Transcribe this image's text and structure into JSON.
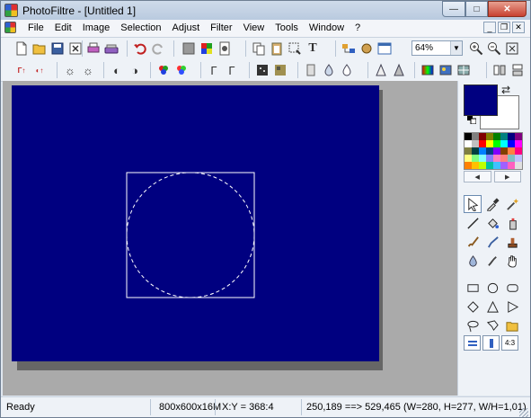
{
  "window": {
    "title": "PhotoFiltre - [Untitled 1]"
  },
  "menu": {
    "items": [
      "File",
      "Edit",
      "Image",
      "Selection",
      "Adjust",
      "Filter",
      "View",
      "Tools",
      "Window",
      "?"
    ]
  },
  "toolbar": {
    "zoom_value": "64%"
  },
  "canvas": {
    "background": "#000080",
    "foreground_color": "#000080",
    "background_color": "#ffffff"
  },
  "palette": {
    "colors": [
      "#000000",
      "#808080",
      "#800000",
      "#808000",
      "#008000",
      "#008080",
      "#000080",
      "#800080",
      "#ffffff",
      "#c0c0c0",
      "#ff0000",
      "#ffff00",
      "#00ff00",
      "#00ffff",
      "#0000ff",
      "#ff00ff",
      "#808040",
      "#004040",
      "#0080ff",
      "#004080",
      "#8000ff",
      "#804000",
      "#ff8040",
      "#ff0080",
      "#ffff80",
      "#80ff80",
      "#80ffff",
      "#8080ff",
      "#ff80c0",
      "#ff8080",
      "#80c0c0",
      "#c0c0ff",
      "#ff8000",
      "#ffc000",
      "#c0ff00",
      "#00c0a0",
      "#40c0ff",
      "#a060ff",
      "#ff60c0",
      "#e0e0e0"
    ]
  },
  "status": {
    "state": "Ready",
    "image_size": "800x600x16M",
    "cursor": "X:Y = 368:4",
    "selection": "250,189 ==> 529,465 (W=280, H=277, W/H=1,01)"
  }
}
